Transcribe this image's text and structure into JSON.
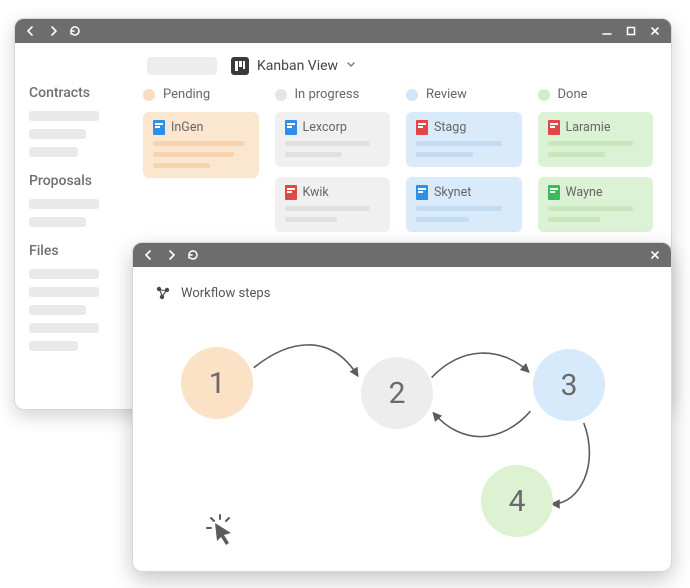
{
  "main_window": {
    "view_label": "Kanban View",
    "sidebar": {
      "sections": [
        {
          "title": "Contracts"
        },
        {
          "title": "Proposals"
        },
        {
          "title": "Files"
        }
      ]
    },
    "board": {
      "columns": [
        {
          "name": "Pending",
          "dot_color": "orange",
          "cards": [
            {
              "title": "InGen",
              "icon_color": "blue",
              "theme": "orange"
            }
          ]
        },
        {
          "name": "In progress",
          "dot_color": "grey",
          "cards": [
            {
              "title": "Lexcorp",
              "icon_color": "blue",
              "theme": "grey"
            },
            {
              "title": "Kwik",
              "icon_color": "red",
              "theme": "grey"
            }
          ]
        },
        {
          "name": "Review",
          "dot_color": "blue",
          "cards": [
            {
              "title": "Stagg",
              "icon_color": "red",
              "theme": "blue"
            },
            {
              "title": "Skynet",
              "icon_color": "blue",
              "theme": "blue"
            }
          ]
        },
        {
          "name": "Done",
          "dot_color": "green",
          "cards": [
            {
              "title": "Laramie",
              "icon_color": "red",
              "theme": "green"
            },
            {
              "title": "Wayne",
              "icon_color": "green",
              "theme": "green"
            }
          ]
        }
      ]
    }
  },
  "modal": {
    "title": "Workflow steps",
    "steps": [
      {
        "label": "1"
      },
      {
        "label": "2"
      },
      {
        "label": "3"
      },
      {
        "label": "4"
      }
    ]
  }
}
